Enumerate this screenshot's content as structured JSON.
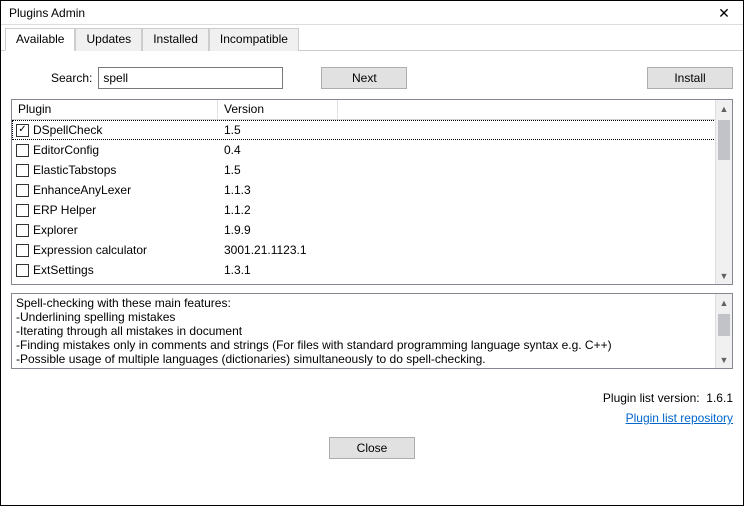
{
  "window": {
    "title": "Plugins Admin"
  },
  "tabs": [
    {
      "label": "Available"
    },
    {
      "label": "Updates"
    },
    {
      "label": "Installed"
    },
    {
      "label": "Incompatible"
    }
  ],
  "search": {
    "label": "Search:",
    "value": "spell",
    "next_label": "Next",
    "install_label": "Install"
  },
  "columns": {
    "plugin": "Plugin",
    "version": "Version"
  },
  "plugins": [
    {
      "name": "DSpellCheck",
      "version": "1.5",
      "checked": true,
      "selected": true
    },
    {
      "name": "EditorConfig",
      "version": "0.4",
      "checked": false
    },
    {
      "name": "ElasticTabstops",
      "version": "1.5",
      "checked": false
    },
    {
      "name": "EnhanceAnyLexer",
      "version": "1.1.3",
      "checked": false
    },
    {
      "name": "ERP Helper",
      "version": "1.1.2",
      "checked": false
    },
    {
      "name": "Explorer",
      "version": "1.9.9",
      "checked": false
    },
    {
      "name": "Expression calculator",
      "version": "3001.21.1123.1",
      "checked": false
    },
    {
      "name": "ExtSettings",
      "version": "1.3.1",
      "checked": false
    }
  ],
  "description": "Spell-checking with these main features:\n-Underlining spelling mistakes\n-Iterating through all mistakes in document\n-Finding mistakes only in comments and strings (For files with standard programming language syntax e.g. C++)\n-Possible usage of multiple languages (dictionaries) simultaneously to do spell-checking.\n-Getting suggestions for words by either using default Notepad++ menu or separate context menu called by special button appearing under word.",
  "footer": {
    "version_label": "Plugin list version:",
    "version_value": "1.6.1",
    "repo_link": "Plugin list repository",
    "close_label": "Close"
  }
}
